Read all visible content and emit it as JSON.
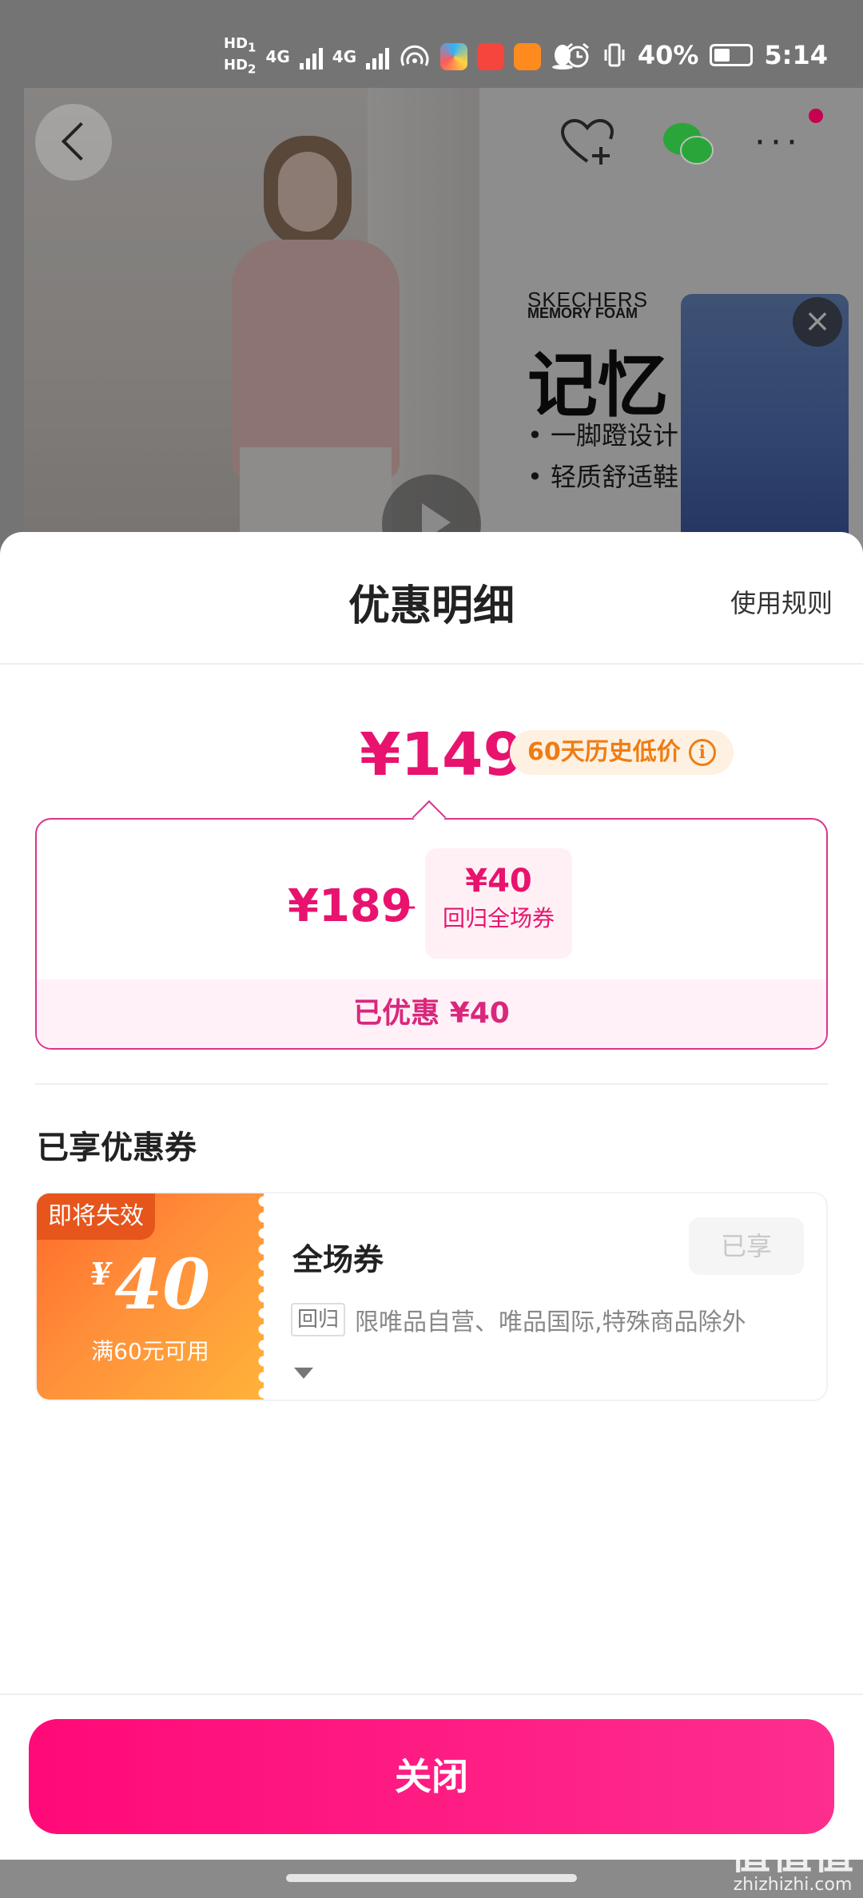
{
  "status_bar": {
    "hd1": "HD",
    "hd1_sub": "1",
    "hd2": "HD",
    "hd2_sub": "2",
    "net1": "4G",
    "net2": "4G",
    "battery": "40%",
    "time": "5:14"
  },
  "background": {
    "brand_line1": "SKECHERS",
    "brand_line2": "MEMORY FOAM",
    "headline": "记忆",
    "bullet1": "• 一脚蹬设计",
    "bullet2": "• 轻质舒适鞋",
    "thumbnail_close": "×"
  },
  "sheet": {
    "title": "优惠明细",
    "rules_link": "使用规则",
    "final_price": "¥149",
    "history_tag": "60天历史低价",
    "info_icon": "i",
    "original_price": "¥189",
    "minus_sign": "-",
    "coupon_chip_amount": "¥40",
    "coupon_chip_name": "回归全场券",
    "saved_text": "已优惠 ¥40",
    "section_title": "已享优惠券",
    "coupon": {
      "expiry_tag": "即将失效",
      "currency": "¥",
      "amount": "40",
      "condition": "满60元可用",
      "name": "全场券",
      "status": "已享",
      "return_tag": "回归",
      "description": "限唯品自营、唯品国际,特殊商品除外"
    },
    "close_button": "关闭"
  },
  "watermark": {
    "big": "值值值",
    "small": "zhizhizhi.com"
  },
  "colors": {
    "accent": "#e8136e",
    "history": "#ee7d14",
    "button": "#ff0a78"
  }
}
